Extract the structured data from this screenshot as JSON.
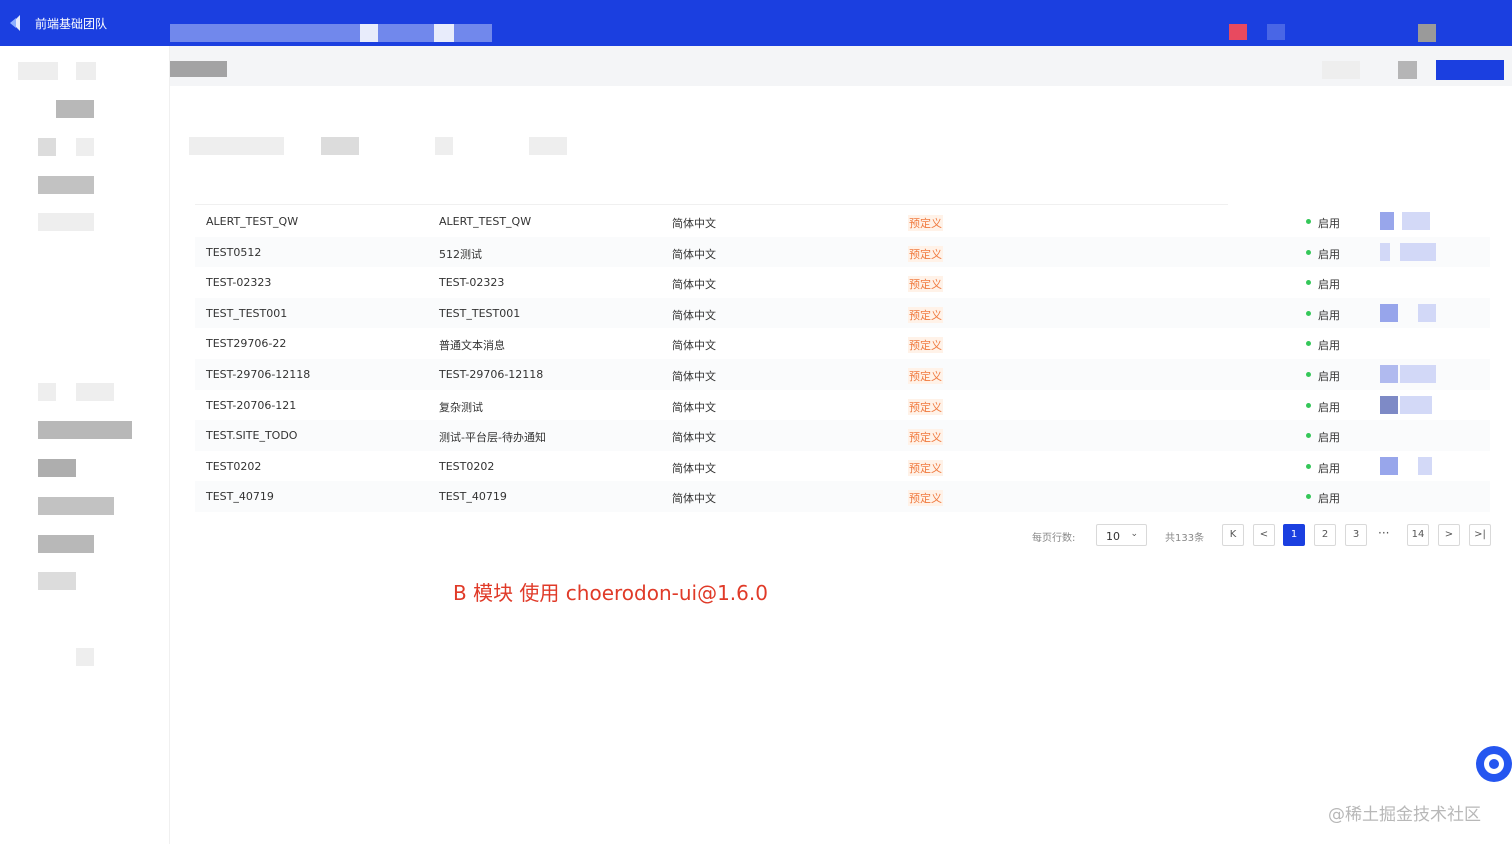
{
  "header": {
    "team_name": "前端基础团队",
    "accent": "#1b3fe0"
  },
  "table": {
    "rows": [
      {
        "code": "ALERT_TEST_QW",
        "name": "ALERT_TEST_QW",
        "language": "简体中文",
        "type": "预定义",
        "status": "启用"
      },
      {
        "code": "TEST0512",
        "name": "512测试",
        "language": "简体中文",
        "type": "预定义",
        "status": "启用"
      },
      {
        "code": "TEST-02323",
        "name": "TEST-02323",
        "language": "简体中文",
        "type": "预定义",
        "status": "启用"
      },
      {
        "code": "TEST_TEST001",
        "name": "TEST_TEST001",
        "language": "简体中文",
        "type": "预定义",
        "status": "启用"
      },
      {
        "code": "TEST29706-22",
        "name": "普通文本消息",
        "language": "简体中文",
        "type": "预定义",
        "status": "启用"
      },
      {
        "code": "TEST-29706-12118",
        "name": "TEST-29706-12118",
        "language": "简体中文",
        "type": "预定义",
        "status": "启用"
      },
      {
        "code": "TEST-20706-121",
        "name": "复杂测试",
        "language": "简体中文",
        "type": "预定义",
        "status": "启用"
      },
      {
        "code": "TEST.SITE_TODO",
        "name": "测试-平台层-待办通知",
        "language": "简体中文",
        "type": "预定义",
        "status": "启用"
      },
      {
        "code": "TEST0202",
        "name": "TEST0202",
        "language": "简体中文",
        "type": "预定义",
        "status": "启用"
      },
      {
        "code": "TEST_40719",
        "name": "TEST_40719",
        "language": "简体中文",
        "type": "预定义",
        "status": "启用"
      }
    ],
    "status_color": "#34c759",
    "type_color": "#f07a3f"
  },
  "pagination": {
    "rows_per_page_label": "每页行数:",
    "page_size": "10",
    "total": "共133条",
    "first": "K",
    "prev": "<",
    "pages": [
      "1",
      "2",
      "3"
    ],
    "ellipsis": "···",
    "last_page": "14",
    "next": ">",
    "last": ">|"
  },
  "annotation": "B 模块 使用 choerodon-ui@1.6.0",
  "watermark": "@稀土掘金技术社区"
}
